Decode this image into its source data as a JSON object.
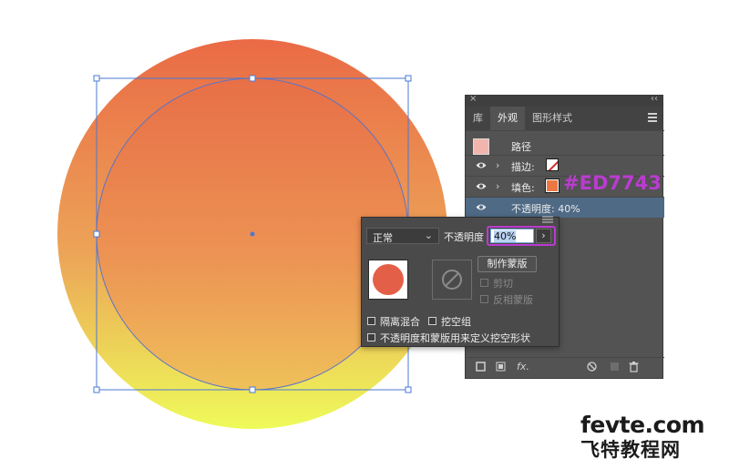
{
  "canvas": {
    "gradient_top_color": "#EA6E48",
    "gradient_bottom_color": "#EDF95A",
    "inner_fill_color": "#ED7743",
    "selection_color": "#4A78D6"
  },
  "panel": {
    "tabs": [
      {
        "label": "库",
        "active": false
      },
      {
        "label": "外观",
        "active": true
      },
      {
        "label": "图形样式",
        "active": false
      }
    ],
    "rows": {
      "path_label": "路径",
      "stroke_label": "描边:",
      "fill_label": "填色:",
      "fill_hex_annotation": "#ED7743",
      "opacity_label": "不透明度: 40%"
    },
    "bottom_icons": [
      "new-stroke-icon",
      "new-fill-icon",
      "fx-icon",
      "clear-icon",
      "duplicate-icon",
      "trash-icon"
    ],
    "fx_label": "fx."
  },
  "transparency": {
    "blend_mode": "正常",
    "opacity_label": "不透明度",
    "opacity_value": "40%",
    "make_mask_label": "制作蒙版",
    "clip_label": "剪切",
    "invert_mask_label": "反相蒙版",
    "isolate_blending_label": "隔离混合",
    "knockout_group_label": "挖空组",
    "opacity_mask_knockout_label": "不透明度和蒙版用来定义挖空形状"
  },
  "watermark": {
    "site": "fevte.com",
    "name": "飞特教程网"
  }
}
